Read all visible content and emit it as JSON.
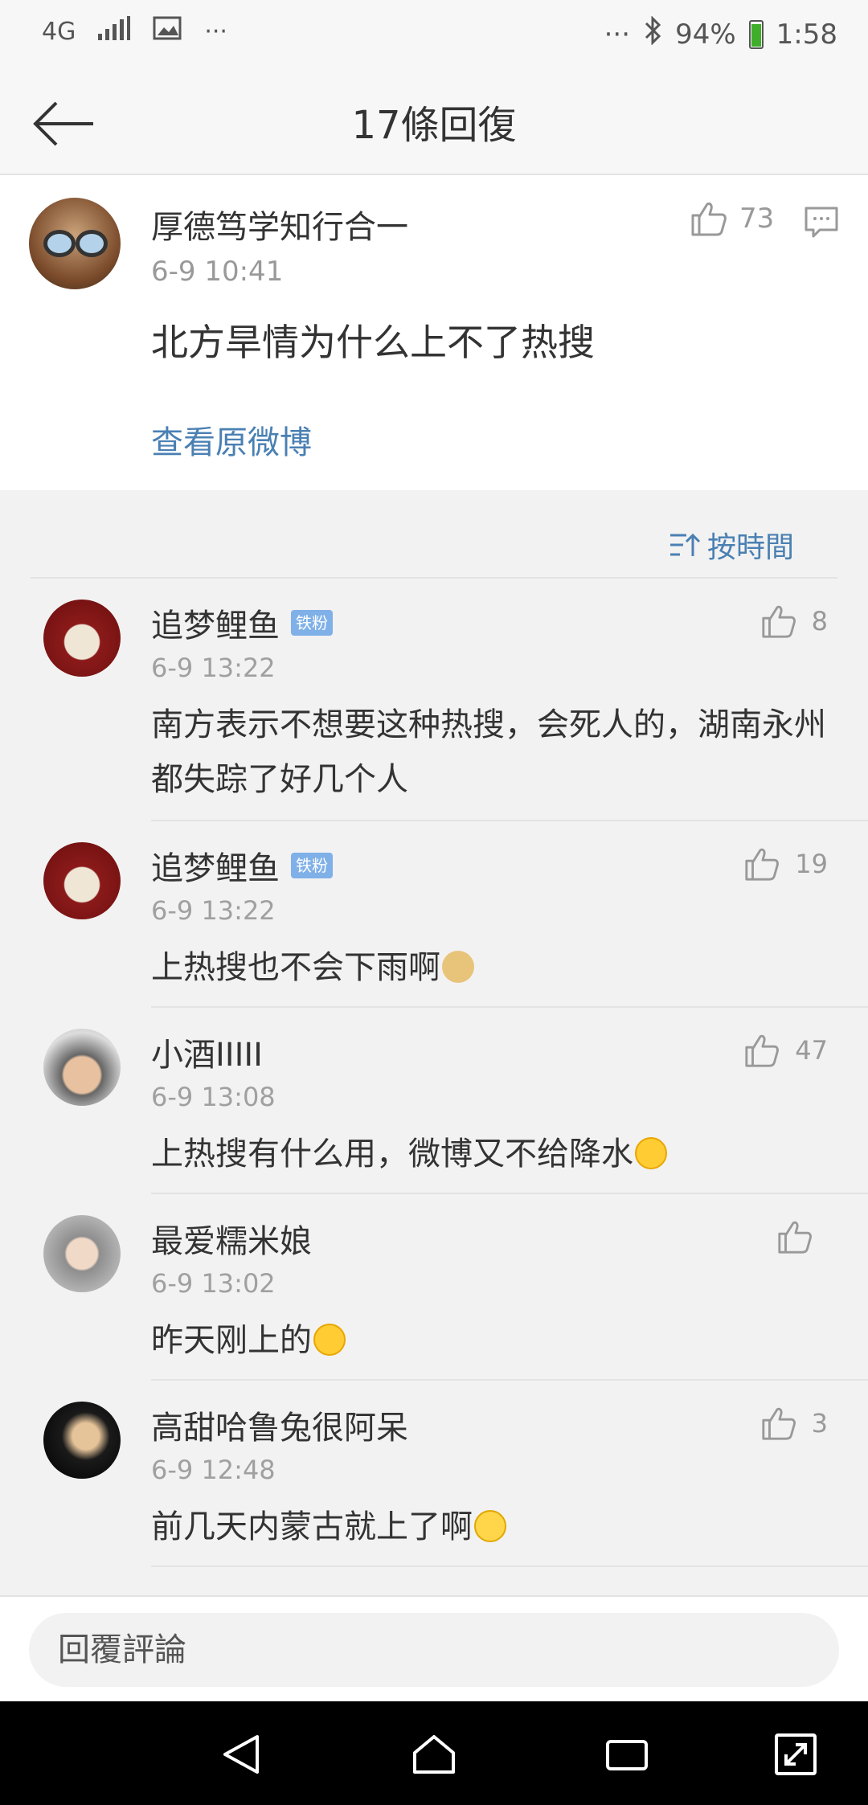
{
  "status_bar": {
    "network": "4G",
    "signal": "signal-icon",
    "overflow_left": "···",
    "overflow_right": "···",
    "battery_percent": "94%",
    "time": "1:58"
  },
  "header": {
    "title": "17條回復"
  },
  "original_post": {
    "author": "厚德笃学知行合一",
    "time": "6-9 10:41",
    "likes": "73",
    "text": "北方旱情为什么上不了热搜",
    "view_original": "查看原微博"
  },
  "sort": {
    "label": "按時間"
  },
  "comments": [
    {
      "author": "追梦鲤鱼",
      "badge": "铁粉",
      "time": "6-9 13:22",
      "text": "南方表示不想要这种热搜，会死人的，湖南永州都失踪了好几个人",
      "likes": "8"
    },
    {
      "author": "追梦鲤鱼",
      "badge": "铁粉",
      "time": "6-9 13:22",
      "text": "上热搜也不会下雨啊",
      "likes": "19"
    },
    {
      "author": "小酒IIIII",
      "time": "6-9 13:08",
      "text": "上热搜有什么用，微博又不给降水",
      "likes": "47"
    },
    {
      "author": "最爱糯米娘",
      "time": "6-9 13:02",
      "text": "昨天刚上的",
      "likes": ""
    },
    {
      "author": "高甜哈鲁兔很阿呆",
      "time": "6-9 12:48",
      "text": "前几天内蒙古就上了啊",
      "likes": "3"
    }
  ],
  "reply": {
    "placeholder": "回覆評論"
  },
  "colors": {
    "link": "#4a80b3",
    "badge": "#7fb0e8",
    "muted_text": "#999999"
  }
}
